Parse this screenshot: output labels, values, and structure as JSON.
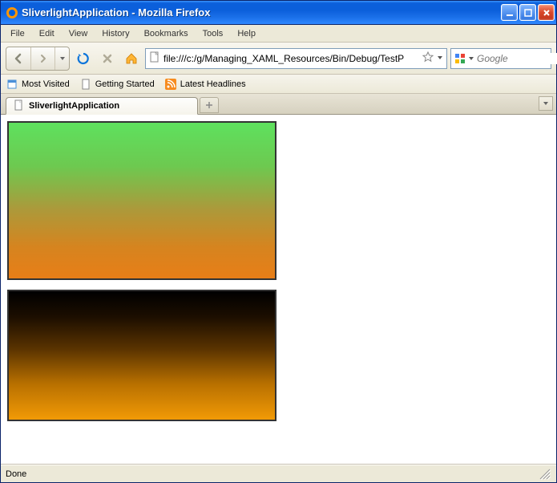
{
  "window": {
    "title": "SliverlightApplication - Mozilla Firefox"
  },
  "menu": {
    "file": "File",
    "edit": "Edit",
    "view": "View",
    "history": "History",
    "bookmarks": "Bookmarks",
    "tools": "Tools",
    "help": "Help"
  },
  "toolbar": {
    "url": "file:///c:/g/Managing_XAML_Resources/Bin/Debug/TestP",
    "search_placeholder": "Google"
  },
  "bookmarks": {
    "most_visited": "Most Visited",
    "getting_started": "Getting Started",
    "latest_headlines": "Latest Headlines"
  },
  "tab": {
    "title": "SliverlightApplication"
  },
  "status": {
    "text": "Done"
  }
}
